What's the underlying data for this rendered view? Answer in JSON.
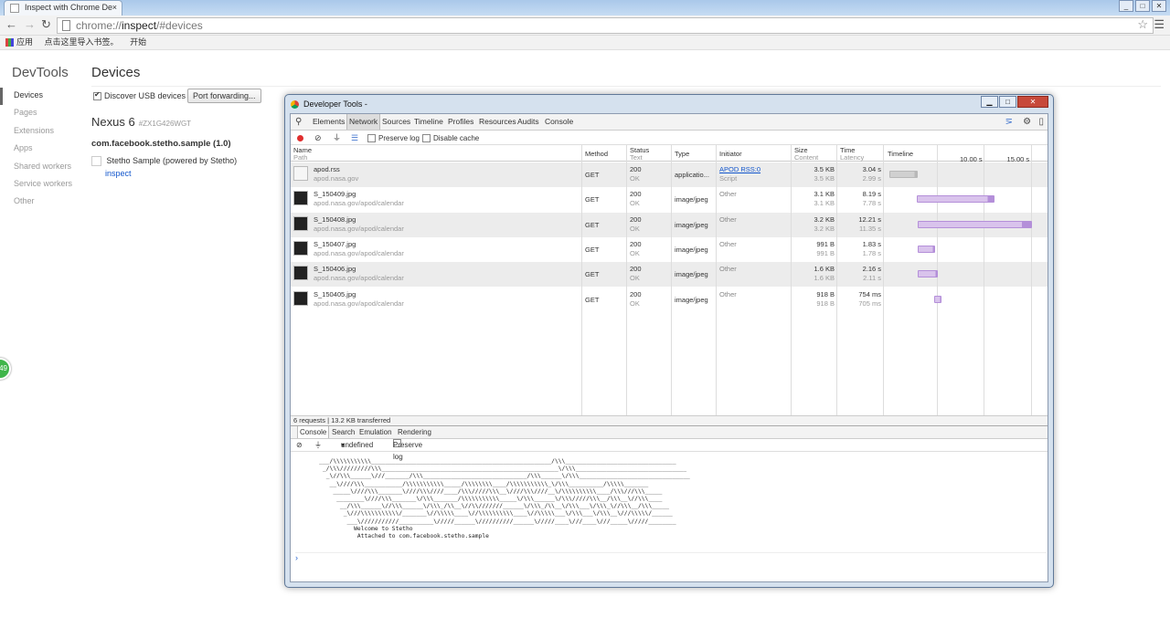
{
  "browser": {
    "tab_title": "Inspect with Chrome De",
    "tab_close": "×",
    "url_prefix": "chrome://",
    "url_host": "inspect",
    "url_path": "/#devices",
    "bookmarks": [
      "应用",
      "点击这里导入书签。",
      "开始"
    ]
  },
  "sidebar": {
    "title": "DevTools",
    "items": [
      "Devices",
      "Pages",
      "Extensions",
      "Apps",
      "Shared workers",
      "Service workers",
      "Other"
    ]
  },
  "devices": {
    "title": "Devices",
    "discover_label": "Discover USB devices",
    "discover_checked": true,
    "port_forwarding": "Port forwarding...",
    "device_name": "Nexus 6",
    "device_serial": "#ZX1G426WGT",
    "app_name": "com.facebook.stetho.sample (1.0)",
    "target_title": "Stetho Sample (powered by Stetho)",
    "inspect_link": "inspect"
  },
  "badge": "49",
  "devtools": {
    "window_title": "Developer Tools -",
    "tabs": [
      "Elements",
      "Network",
      "Sources",
      "Timeline",
      "Profiles",
      "Resources",
      "Audits",
      "Console"
    ],
    "selected_tab": "Network",
    "preserve_log": "Preserve log",
    "disable_cache": "Disable cache",
    "columns": {
      "name": "Name",
      "path": "Path",
      "method": "Method",
      "status": "Status",
      "text": "Text",
      "type": "Type",
      "initiator": "Initiator",
      "size": "Size",
      "content": "Content",
      "time": "Time",
      "latency": "Latency",
      "timeline": "Timeline",
      "tick1": "10.00 s",
      "tick2": "15.00 s"
    },
    "rows": [
      {
        "name": "apod.rss",
        "path": "apod.nasa.gov",
        "method": "GET",
        "status": "200",
        "text": "OK",
        "type": "applicatio...",
        "initiator": "APOD RSS:0",
        "initiator_sub": "Script",
        "size": "3.5 KB",
        "content": "3.5 KB",
        "time": "3.04 s",
        "latency": "2.99 s",
        "bar_start": 0.0,
        "bar_end": 3.04,
        "bar_color": "#d0d0d0",
        "bar_end_color": "#b8b8b8"
      },
      {
        "name": "S_150409.jpg",
        "path": "apod.nasa.gov/apod/calendar",
        "method": "GET",
        "status": "200",
        "text": "OK",
        "type": "image/jpeg",
        "initiator": "Other",
        "initiator_sub": "",
        "size": "3.1 KB",
        "content": "3.1 KB",
        "time": "8.19 s",
        "latency": "7.78 s",
        "bar_start": 2.95,
        "bar_end": 11.14,
        "bar_color": "#d9c3ec",
        "bar_end_color": "#b48fd9"
      },
      {
        "name": "S_150408.jpg",
        "path": "apod.nasa.gov/apod/calendar",
        "method": "GET",
        "status": "200",
        "text": "OK",
        "type": "image/jpeg",
        "initiator": "Other",
        "initiator_sub": "",
        "size": "3.2 KB",
        "content": "3.2 KB",
        "time": "12.21 s",
        "latency": "11.35 s",
        "bar_start": 2.97,
        "bar_end": 15.18,
        "bar_color": "#d9c3ec",
        "bar_end_color": "#b48fd9"
      },
      {
        "name": "S_150407.jpg",
        "path": "apod.nasa.gov/apod/calendar",
        "method": "GET",
        "status": "200",
        "text": "OK",
        "type": "image/jpeg",
        "initiator": "Other",
        "initiator_sub": "",
        "size": "991 B",
        "content": "991 B",
        "time": "1.83 s",
        "latency": "1.78 s",
        "bar_start": 3.0,
        "bar_end": 4.83,
        "bar_color": "#d9c3ec",
        "bar_end_color": "#b48fd9"
      },
      {
        "name": "S_150406.jpg",
        "path": "apod.nasa.gov/apod/calendar",
        "method": "GET",
        "status": "200",
        "text": "OK",
        "type": "image/jpeg",
        "initiator": "Other",
        "initiator_sub": "",
        "size": "1.6 KB",
        "content": "1.6 KB",
        "time": "2.16 s",
        "latency": "2.11 s",
        "bar_start": 3.0,
        "bar_end": 5.16,
        "bar_color": "#d9c3ec",
        "bar_end_color": "#b48fd9"
      },
      {
        "name": "S_150405.jpg",
        "path": "apod.nasa.gov/apod/calendar",
        "method": "GET",
        "status": "200",
        "text": "OK",
        "type": "image/jpeg",
        "initiator": "Other",
        "initiator_sub": "",
        "size": "918 B",
        "content": "918 B",
        "time": "754 ms",
        "latency": "705 ms",
        "bar_start": 4.8,
        "bar_end": 5.55,
        "bar_color": "#d9c3ec",
        "bar_end_color": "#b48fd9"
      }
    ],
    "summary": "6 requests | 13.2 KB transferred",
    "drawer_tabs": [
      "Console",
      "Search",
      "Emulation",
      "Rendering"
    ],
    "console_context": "undefined",
    "console_preserve_log": "Preserve log",
    "console_output": "    ___/\\\\\\\\\\\\\\\\\\\\\\____________________________________________________/\\\\\\________________________________\n     _/\\\\\\/////////\\\\\\___________________________________________________\\/\\\\\\________________________________\n      _\\//\\\\\\______\\///_______/\\\\\\______________________________/\\\\\\______\\/\\\\\\________________________________\n       __\\////\\\\\\___________/\\\\\\\\\\\\\\\\\\\\\\_____/\\\\\\\\\\\\\\\\____/\\\\\\\\\\\\\\\\\\\\\\_\\/\\\\\\__________/\\\\\\\\\\_______\n        _____\\////\\\\\\_______\\////\\\\\\////____/\\\\\\/////\\\\\\__\\////\\\\\\////__\\/\\\\\\\\\\\\\\\\\\\\____/\\\\\\///\\\\\\_____\n         ________\\////\\\\\\_______\\/\\\\\\_______/\\\\\\\\\\\\\\\\\\\\\\_____\\/\\\\\\______\\/\\\\\\/////\\\\\\__/\\\\\\__\\//\\\\\\____\n          __/\\\\\\______\\//\\\\\\______\\/\\\\\\_/\\\\__\\//\\\\///////______\\/\\\\\\_/\\\\__\\/\\\\\\___\\/\\\\\\_\\//\\\\\\__/\\\\\\_____\n           _\\///\\\\\\\\\\\\\\\\\\\\\\/_______\\//\\\\\\\\\\____\\//\\\\\\\\\\\\\\\\\\\\____\\//\\\\\\\\\\___\\/\\\\\\___\\/\\\\\\__\\///\\\\\\\\\\/______\n            ___\\///////////__________\\/////______\\//////////______\\/////____\\///____\\///_____\\/////________\n              Welcome to Stetho\n               Attached to com.facebook.stetho.sample",
    "prompt": "›"
  },
  "chart_data": {
    "type": "bar",
    "xlabel": "",
    "ylabel": "",
    "x_range_seconds": [
      0,
      16.5
    ],
    "ticks": [
      "10.00 s",
      "15.00 s"
    ],
    "categories": [
      "apod.rss",
      "S_150409.jpg",
      "S_150408.jpg",
      "S_150407.jpg",
      "S_150406.jpg",
      "S_150405.jpg"
    ],
    "series": [
      {
        "name": "Time",
        "values": [
          3.04,
          8.19,
          12.21,
          1.83,
          2.16,
          0.754
        ]
      },
      {
        "name": "Latency",
        "values": [
          2.99,
          7.78,
          11.35,
          1.78,
          2.11,
          0.705
        ]
      }
    ]
  }
}
